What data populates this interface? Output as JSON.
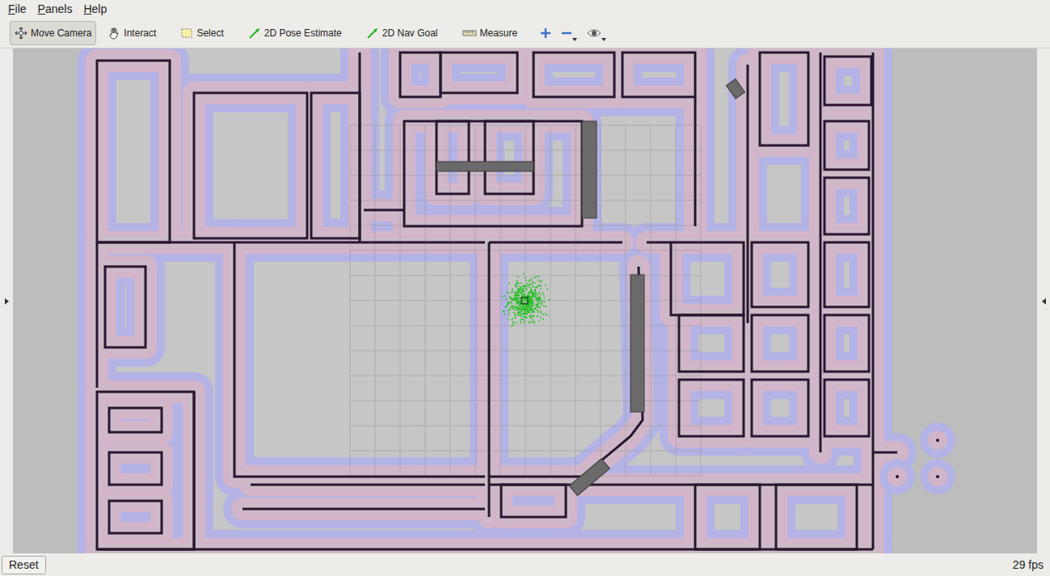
{
  "menu": [
    {
      "label": "File"
    },
    {
      "label": "Panels"
    },
    {
      "label": "Help"
    }
  ],
  "toolbar": [
    {
      "label": "Move Camera",
      "selected": true
    },
    {
      "label": "Interact",
      "selected": false
    },
    {
      "label": "Select",
      "selected": false
    },
    {
      "label": "2D Pose Estimate",
      "selected": false
    },
    {
      "label": "2D Nav Goal",
      "selected": false
    },
    {
      "label": "Measure",
      "selected": false
    }
  ],
  "status_bar": {
    "button": "Reset",
    "fps": "29 fps"
  }
}
